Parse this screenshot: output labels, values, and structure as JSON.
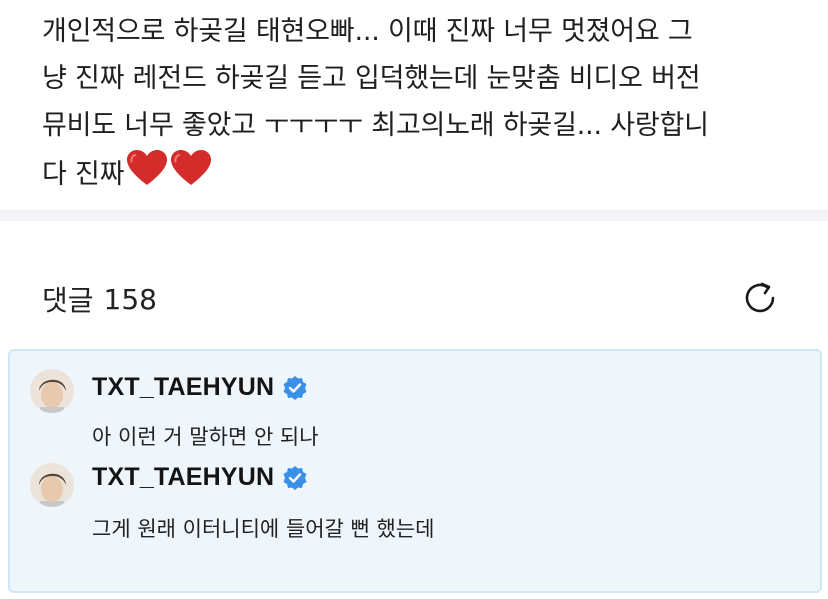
{
  "post": {
    "lines": [
      "개인적으로 하곶길 태현오빠... 이때 진짜 너무 멋졌어요 그",
      "냥 진짜 레전드 하곶길 듣고 입덕했는데 눈맞춤 비디오 버전",
      "뮤비도 너무 좋았고 ㅜㅜㅜㅜ 최고의노래 하곶길... 사랑합니",
      "다 진짜"
    ],
    "heart_count": 2,
    "heart_color": "#d42b2b"
  },
  "comments_section": {
    "label": "댓글",
    "count": "158",
    "refresh_icon": "refresh-icon"
  },
  "highlight": {
    "background": "#eef6fc",
    "border": "#cfe6f5"
  },
  "comments": [
    {
      "author": "TXT_TAEHYUN",
      "verified": true,
      "text": "아 이런 거 말하면 안 되나"
    },
    {
      "author": "TXT_TAEHYUN",
      "verified": true,
      "text": "그게 원래 이터니티에 들어갈 뻔 했는데"
    }
  ],
  "colors": {
    "verified_badge": "#3a8fe6"
  }
}
